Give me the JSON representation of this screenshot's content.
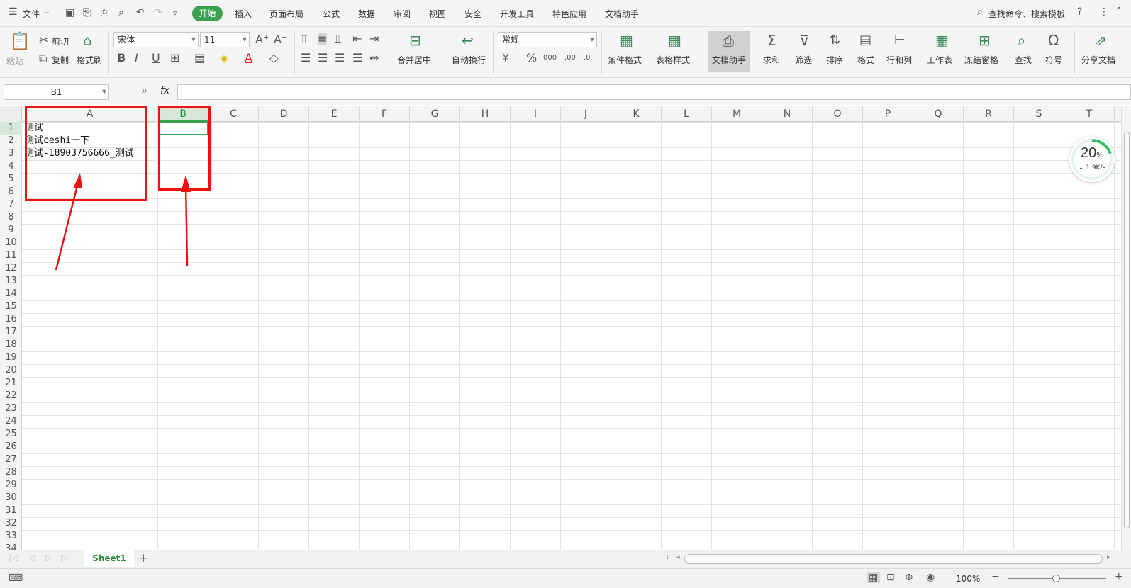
{
  "menubar": {
    "file": "文件",
    "tabs": [
      "开始",
      "插入",
      "页面布局",
      "公式",
      "数据",
      "审阅",
      "视图",
      "安全",
      "开发工具",
      "特色应用",
      "文档助手"
    ],
    "search": "查找命令、搜索模板"
  },
  "ribbon": {
    "paste": "粘贴",
    "cut": "剪切",
    "copy": "复制",
    "format_painter": "格式刷",
    "font_name": "宋体",
    "font_size": "11",
    "merge_center": "合并居中",
    "wrap_text": "自动换行",
    "number_format": "常规",
    "cond_format": "条件格式",
    "table_style": "表格样式",
    "doc_assistant": "文档助手",
    "sum": "求和",
    "filter": "筛选",
    "sort": "排序",
    "format": "格式",
    "row_col": "行和列",
    "worksheet": "工作表",
    "freeze": "冻结窗格",
    "find": "查找",
    "symbol": "符号",
    "share": "分享文档"
  },
  "formula_bar": {
    "name_box": "B1",
    "fx": "fx",
    "value": ""
  },
  "columns": [
    "A",
    "B",
    "C",
    "D",
    "E",
    "F",
    "G",
    "H",
    "I",
    "J",
    "K",
    "L",
    "M",
    "N",
    "O",
    "P",
    "Q",
    "R",
    "S",
    "T"
  ],
  "rows": [
    "1",
    "2",
    "3",
    "4",
    "5",
    "6",
    "7",
    "8",
    "9",
    "10",
    "11",
    "12",
    "13",
    "14",
    "15",
    "16",
    "17",
    "18",
    "19",
    "20",
    "21",
    "22",
    "23",
    "24",
    "25",
    "26",
    "27",
    "28",
    "29",
    "30",
    "31",
    "32",
    "33",
    "34"
  ],
  "cells": {
    "A1": "测试",
    "A2": "测试ceshi一下",
    "A3": "测试-18903756666_测试"
  },
  "selected_cell": "B1",
  "sheet": {
    "tab": "Sheet1",
    "add": "+"
  },
  "status": {
    "zoom": "100%"
  },
  "speed_widget": {
    "percent": "20",
    "percent_sign": "%",
    "rate": "↓ 1.9K/s",
    "level": 0.2
  },
  "colors": {
    "accent": "#3aa14e",
    "annotation": "#ee1111"
  }
}
